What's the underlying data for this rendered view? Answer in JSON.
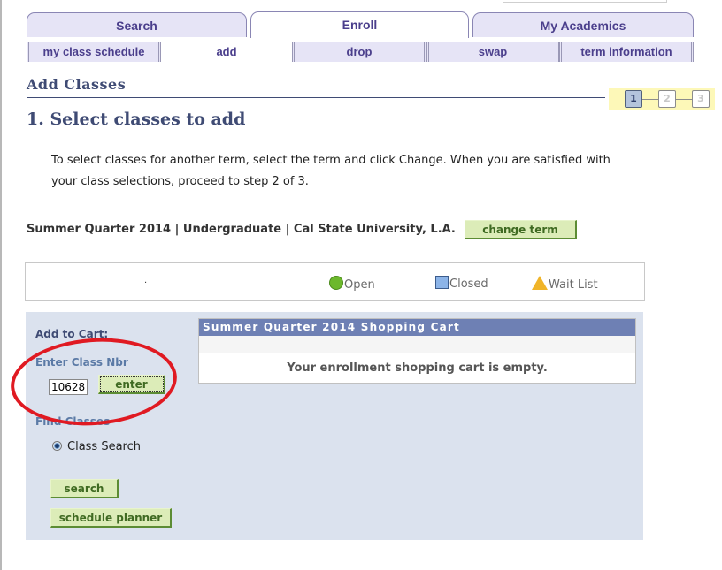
{
  "main_tabs": [
    {
      "label": "Search",
      "active": false
    },
    {
      "label": "Enroll",
      "active": true
    },
    {
      "label": "My Academics",
      "active": false
    }
  ],
  "sub_tabs": [
    {
      "label": "my class schedule",
      "active": false
    },
    {
      "label": "add",
      "active": true
    },
    {
      "label": "drop",
      "active": false
    },
    {
      "label": "swap",
      "active": false
    },
    {
      "label": "term information",
      "active": false
    }
  ],
  "page": {
    "title": "Add Classes",
    "section_title": "1.  Select classes to add",
    "instructions": "To select classes for another term, select the term and click Change.  When you are satisfied with your class selections, proceed to step 2 of 3.",
    "steps": {
      "current": 1,
      "labels": [
        "1",
        "2",
        "3"
      ]
    }
  },
  "term": {
    "text": "Summer Quarter 2014 | Undergraduate | Cal State University, L.A.",
    "change_label": "change term"
  },
  "legend": {
    "dot": ".",
    "open": "Open",
    "closed": "Closed",
    "wait_list": "Wait List",
    "colors": {
      "open": "#6cb82c",
      "closed": "#8cb4e8",
      "wait_list": "#f0b428"
    }
  },
  "add_to_cart": {
    "heading": "Add to Cart:",
    "class_nbr_label": "Enter Class Nbr",
    "class_nbr_value": "10628",
    "enter_label": "enter",
    "find_label": "Find Classes",
    "radio_label": "Class Search",
    "search_label": "search",
    "planner_label": "schedule planner"
  },
  "cart": {
    "title": "Summer Quarter 2014 Shopping Cart",
    "empty_message": "Your enrollment shopping cart is empty."
  }
}
